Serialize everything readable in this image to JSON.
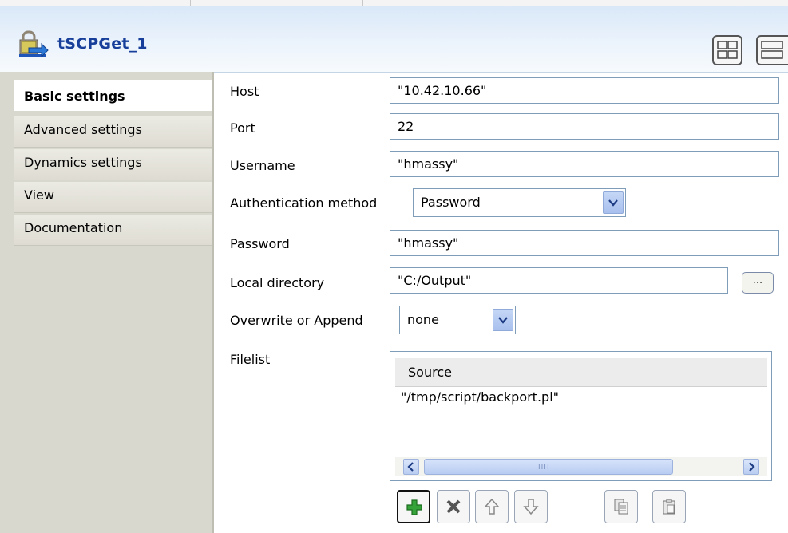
{
  "component": {
    "title": "tSCPGet_1"
  },
  "sidebar": {
    "items": [
      {
        "label": "Basic settings"
      },
      {
        "label": "Advanced settings"
      },
      {
        "label": "Dynamics settings"
      },
      {
        "label": "View"
      },
      {
        "label": "Documentation"
      }
    ],
    "active_index": 0
  },
  "form": {
    "host": {
      "label": "Host",
      "value": "\"10.42.10.66\""
    },
    "port": {
      "label": "Port",
      "value": "22"
    },
    "username": {
      "label": "Username",
      "value": "\"hmassy\""
    },
    "auth": {
      "label": "Authentication method",
      "selected": "Password"
    },
    "password": {
      "label": "Password",
      "value": "\"hmassy\""
    },
    "local_dir": {
      "label": "Local directory",
      "value": "\"C:/Output\"",
      "browse_label": "..."
    },
    "overwrite": {
      "label": "Overwrite or Append",
      "selected": "none"
    },
    "filelist": {
      "label": "Filelist",
      "columns": [
        "Source"
      ],
      "rows": [
        [
          "\"/tmp/script/backport.pl\""
        ]
      ],
      "scroll_grip": "IIII"
    }
  },
  "toolbar": {
    "buttons": [
      {
        "name": "add",
        "enabled": true
      },
      {
        "name": "remove",
        "enabled": false
      },
      {
        "name": "move-up",
        "enabled": false
      },
      {
        "name": "move-down",
        "enabled": false
      },
      {
        "name": "copy",
        "enabled": false
      },
      {
        "name": "paste",
        "enabled": false
      }
    ]
  },
  "colors": {
    "title": "#18409b",
    "sidebar_bg": "#d9d8ce",
    "input_border": "#7f9db9",
    "add_icon_green": "#35a23a"
  }
}
